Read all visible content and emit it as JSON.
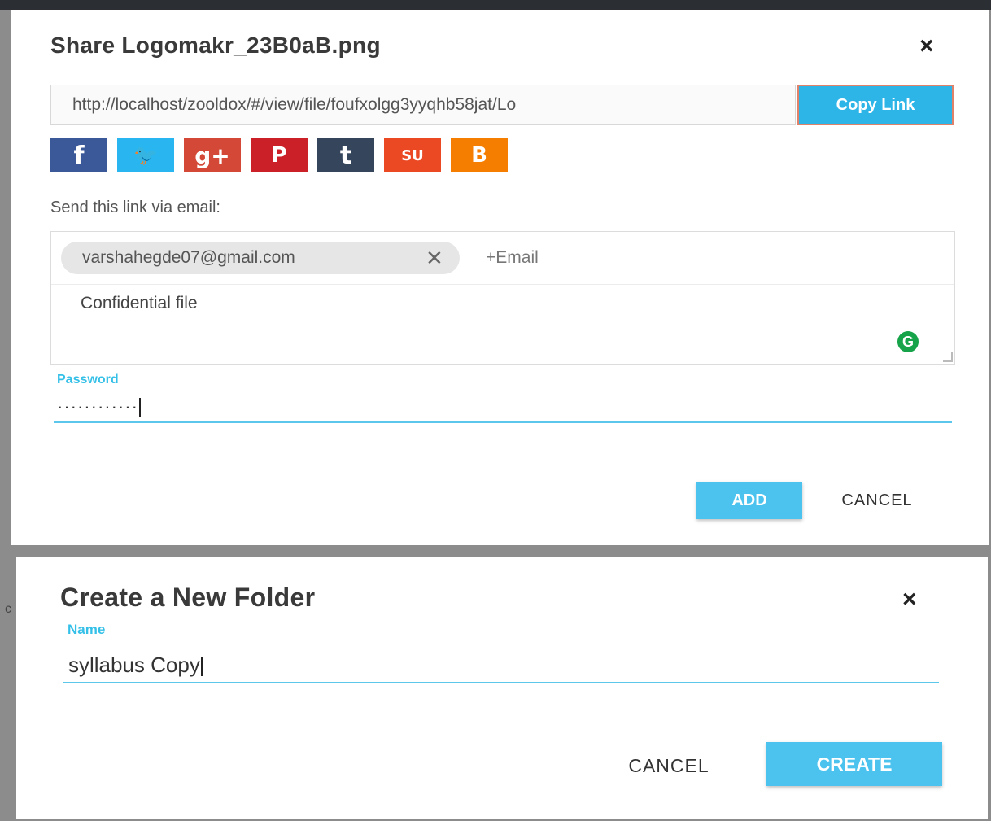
{
  "share_dialog": {
    "title": "Share Logomakr_23B0aB.png",
    "close_glyph": "×",
    "link_value": "http://localhost/zooldox/#/view/file/foufxolgg3yyqhb58jat/Lo",
    "copy_link_label": "Copy Link",
    "social_buttons": [
      {
        "name": "facebook-icon",
        "glyph": "f",
        "color": "#3b5998"
      },
      {
        "name": "twitter-icon",
        "glyph": "🐦",
        "color": "#29b6f0"
      },
      {
        "name": "google-plus-icon",
        "glyph": "g+",
        "color": "#d34836"
      },
      {
        "name": "pinterest-icon",
        "glyph": "P",
        "color": "#cb2027"
      },
      {
        "name": "tumblr-icon",
        "glyph": "t",
        "color": "#35465c"
      },
      {
        "name": "stumbleupon-icon",
        "glyph": "SU",
        "color": "#eb4924"
      },
      {
        "name": "blogger-icon",
        "glyph": "B",
        "color": "#f57d00"
      }
    ],
    "email_label": "Send this link via email:",
    "email_chip": "varshahegde07@gmail.com",
    "chip_remove_glyph": "✕",
    "add_email_placeholder": "+Email",
    "message": "Confidential file",
    "password_label": "Password",
    "password_value": "············",
    "add_label": "ADD",
    "cancel_label": "CANCEL"
  },
  "folder_dialog": {
    "title": "Create a New Folder",
    "close_glyph": "×",
    "name_label": "Name",
    "name_value": "syllabus Copy",
    "cancel_label": "CANCEL",
    "create_label": "CREATE"
  },
  "background_mark": "c"
}
